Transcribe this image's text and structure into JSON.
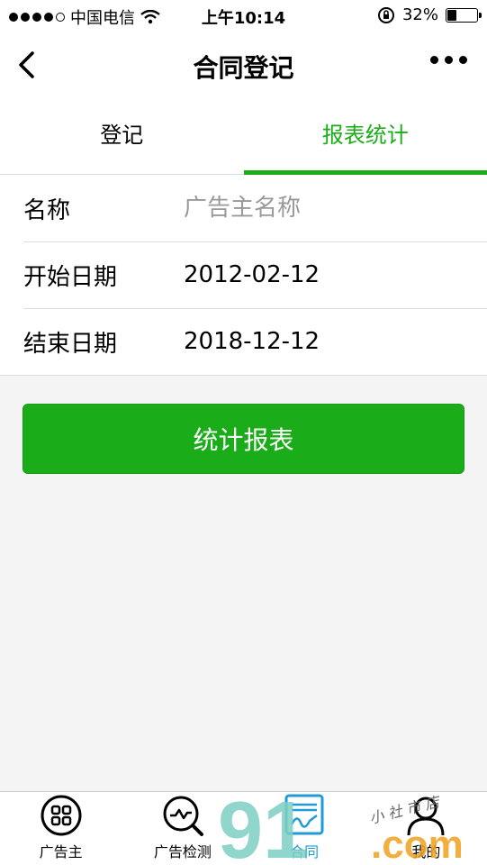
{
  "status_bar": {
    "carrier": "中国电信",
    "time": "上午10:14",
    "battery": "32%",
    "battery_level": 0.32
  },
  "nav": {
    "title": "合同登记",
    "back_icon": "chevron-left-icon",
    "more_icon": "more-dots-icon"
  },
  "tabs": [
    {
      "label": "登记",
      "active": false
    },
    {
      "label": "报表统计",
      "active": true
    }
  ],
  "form": {
    "name_label": "名称",
    "name_placeholder": "广告主名称",
    "name_value": "",
    "start_label": "开始日期",
    "start_value": "2012-02-12",
    "end_label": "结束日期",
    "end_value": "2018-12-12"
  },
  "button": {
    "label": "统计报表"
  },
  "tab_bar": {
    "items": [
      {
        "label": "广告主",
        "icon": "grid-circle-icon"
      },
      {
        "label": "广告检测",
        "icon": "search-wave-icon"
      },
      {
        "label": "合同",
        "icon": "contract-icon",
        "active": true
      },
      {
        "label": "我的",
        "icon": "user-icon"
      }
    ]
  },
  "watermark": {
    "brand": "91",
    "suffix": ".com",
    "note": "小 社 市 店"
  },
  "colors": {
    "accent": "#1aad19",
    "tab_active": "#1f9bd6",
    "background": "#f4f4f4"
  }
}
